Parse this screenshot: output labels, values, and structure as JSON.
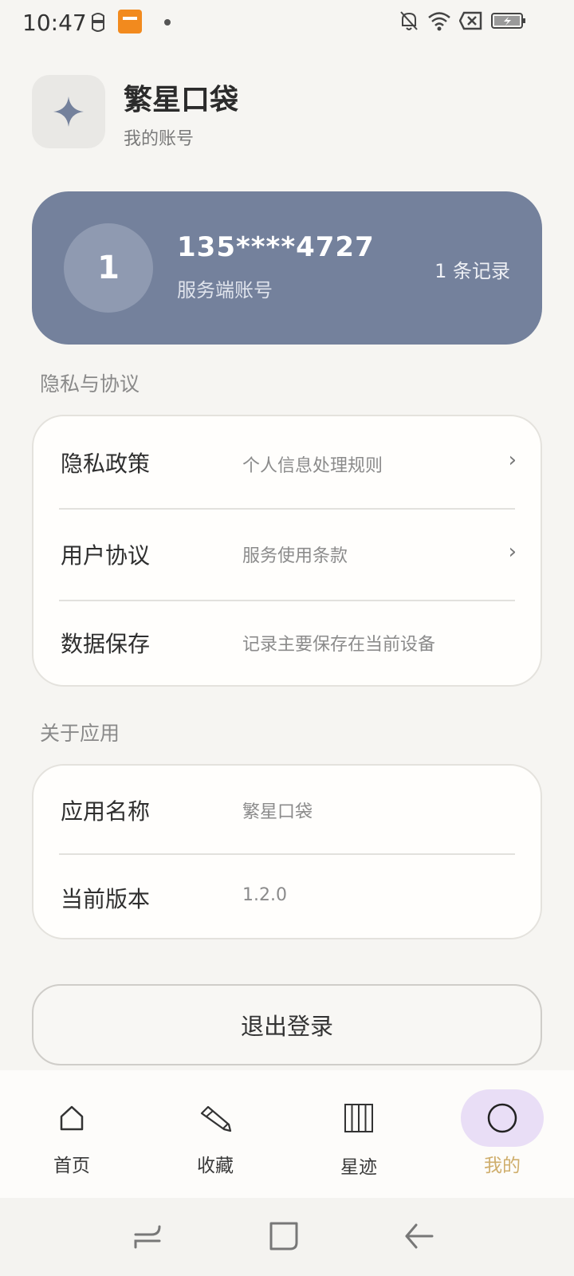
{
  "status_bar": {
    "time": "10:47",
    "icons": [
      "robot-icon",
      "orange-app-icon",
      "notification-dot-icon",
      "bell-off-icon",
      "wifi-icon",
      "sim-x-icon",
      "battery-charging-icon"
    ]
  },
  "header": {
    "title": "繁星口袋",
    "subtitle": "我的账号",
    "logo_icon": "sparkle-icon"
  },
  "account": {
    "avatar_text": "1",
    "phone": "135****4727",
    "type": "服务端账号",
    "records": "1 条记录"
  },
  "privacy_section": {
    "title": "隐私与协议",
    "rows": [
      {
        "label": "隐私政策",
        "value": "个人信息处理规则",
        "chevron": "›"
      },
      {
        "label": "用户协议",
        "value": "服务使用条款",
        "chevron": "›"
      },
      {
        "label": "数据保存",
        "value": "记录主要保存在当前设备"
      }
    ]
  },
  "about_section": {
    "title": "关于应用",
    "rows": [
      {
        "label": "应用名称",
        "value": "繁星口袋"
      },
      {
        "label": "当前版本",
        "value": "1.2.0"
      }
    ]
  },
  "logout_label": "退出登录",
  "bottom_nav": {
    "items": [
      {
        "label": "首页",
        "icon": "home-icon"
      },
      {
        "label": "收藏",
        "icon": "pencil-icon"
      },
      {
        "label": "星迹",
        "icon": "grid-columns-icon"
      },
      {
        "label": "我的",
        "icon": "circle-icon",
        "active": true
      }
    ]
  },
  "colors": {
    "accent_card": "#74819c",
    "active_nav_bg": "#e9def6",
    "active_nav_label": "#cfae6c"
  }
}
